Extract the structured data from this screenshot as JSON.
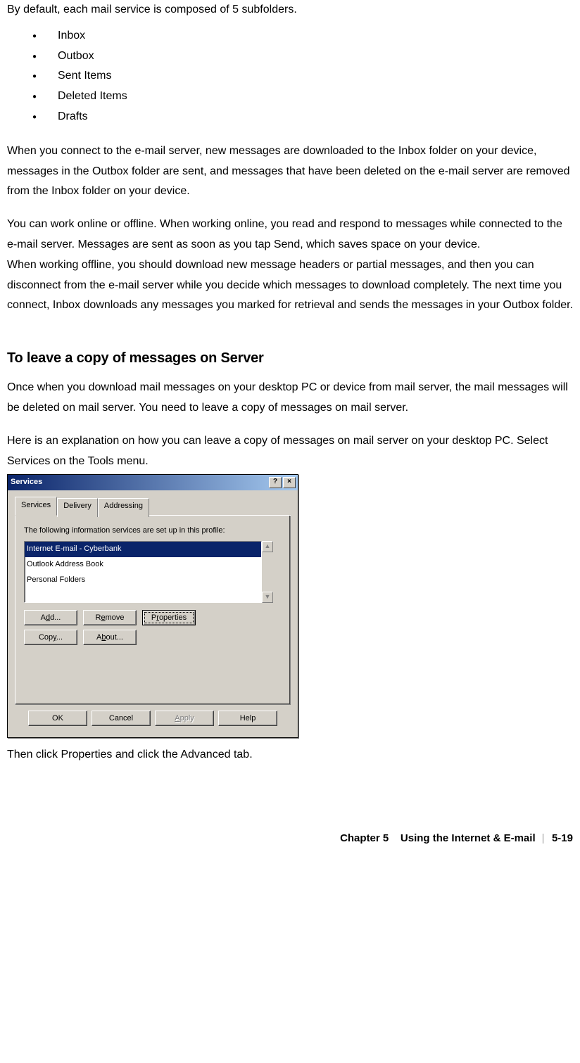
{
  "intro": "By default, each mail service is composed of 5 subfolders.",
  "folders": [
    "Inbox",
    "Outbox",
    "Sent Items",
    "Deleted Items",
    "Drafts"
  ],
  "para1": "When you connect to the e-mail server, new messages are downloaded to the Inbox folder on your device, messages in the Outbox folder are sent, and messages that have been deleted on the e-mail server are removed from the Inbox folder on your device.",
  "para2": "You can work online or offline. When working online, you read and respond to messages while connected to the e-mail server. Messages are sent as soon as you tap Send, which saves space on your device.",
  "para3": "When working offline, you should download new message headers or partial messages, and then you can disconnect from the e-mail server while you decide which messages to download completely. The next time you connect, Inbox downloads any messages you marked for retrieval and sends the messages in your Outbox folder.",
  "heading": "To leave a copy of messages on Server",
  "para4": "Once when you download mail messages on your desktop PC or device from mail server, the mail messages will be deleted on mail server. You need to leave a copy of messages on mail server.",
  "para5": "Here is an explanation on how you can leave a copy of messages on mail server on your desktop PC. Select Services on the Tools menu.",
  "para6": "Then click Properties and click the Advanced tab.",
  "dialog": {
    "title": "Services",
    "help_btn": "?",
    "close_btn": "×",
    "tabs": [
      "Services",
      "Delivery",
      "Addressing"
    ],
    "panel_text": "The following information services are set up in this profile:",
    "items": [
      "Internet E-mail - Cyberbank",
      "Outlook Address Book",
      "Personal Folders"
    ],
    "row1": {
      "add": "Add...",
      "remove": "Remove",
      "properties": "Properties"
    },
    "row2": {
      "copy": "Copy...",
      "about": "About..."
    },
    "bottom": {
      "ok": "OK",
      "cancel": "Cancel",
      "apply": "Apply",
      "help": "Help"
    }
  },
  "footer": {
    "chapter": "Chapter 5",
    "title": "Using the Internet & E-mail",
    "page": "5-19"
  }
}
